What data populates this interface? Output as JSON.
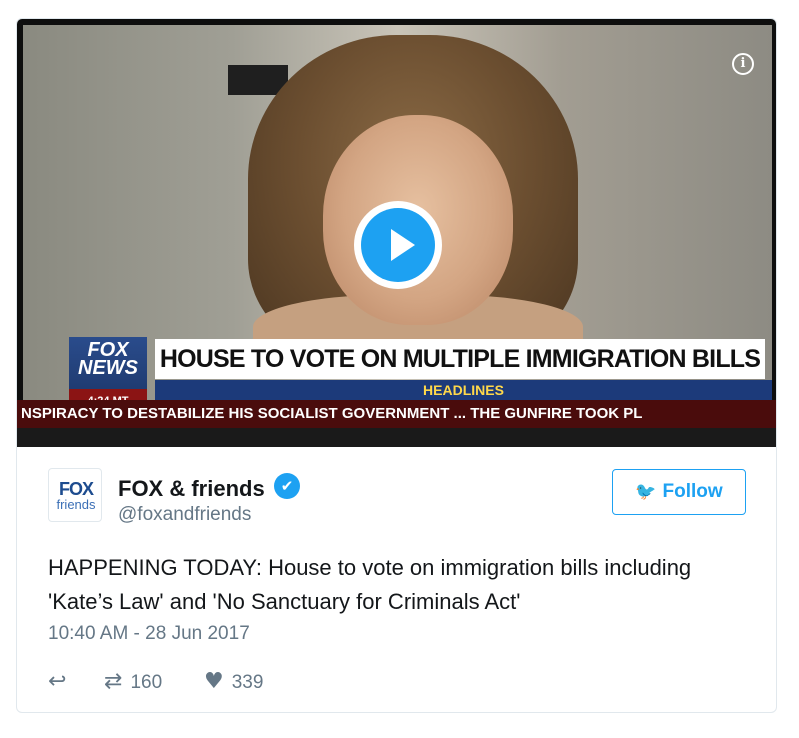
{
  "video": {
    "headline": "HOUSE TO VOTE ON MULTIPLE IMMIGRATION BILLS",
    "section": "HEADLINES",
    "ticker": "NSPIRACY TO DESTABILIZE HIS SOCIALIST GOVERNMENT ...  THE GUNFIRE TOOK PL",
    "logo_line1": "FOX",
    "logo_line2": "NEWS",
    "logo_time": "4:24 MT",
    "info_icon": "i"
  },
  "author": {
    "avatar_line1": "FOX",
    "avatar_line2": "friends",
    "name": "FOX & friends",
    "handle": "@foxandfriends",
    "verified_icon": "verified-check"
  },
  "follow": {
    "label": "Follow",
    "icon": "twitter-bird"
  },
  "tweet": {
    "text": "HAPPENING TODAY: House to vote on immigration bills including 'Kate’s Law' and 'No Sanctuary for Criminals Act'",
    "timestamp": "10:40 AM - 28 Jun 2017"
  },
  "actions": {
    "retweets": "160",
    "likes": "339"
  },
  "colors": {
    "accent": "#1da1f2",
    "muted": "#657786",
    "text": "#14171a"
  }
}
